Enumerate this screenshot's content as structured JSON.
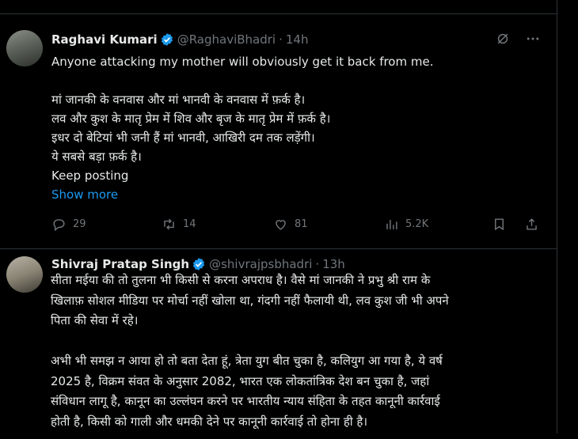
{
  "tweets": [
    {
      "name": "Raghavi Kumari",
      "handle": "@RaghaviBhadri",
      "time": "14h",
      "lines": [
        "Anyone attacking my mother will obviously get it back from me.",
        "",
        "मां जानकी के वनवास और मां भानवी के वनवास में फ़र्क है।",
        "लव और कुश के मातृ प्रेम में शिव और बृज के मातृ प्रेम में फ़र्क है।",
        "इधर दो बेटियां भी जनी हैं मां भानवी, आखिरी दम तक लड़ेंगी।",
        "ये सबसे बड़ा फ़र्क है।",
        "Keep posting"
      ],
      "show_more": "Show more",
      "replies": "29",
      "retweets": "14",
      "likes": "81",
      "views": "5.2K"
    },
    {
      "name": "Shivraj Pratap Singh",
      "handle": "@shivrajpsbhadri",
      "time": "13h",
      "lines": [
        "सीता मईया की तो तुलना भी किसी से करना अपराध है। वैसे मां जानकी ने प्रभु श्री राम के",
        "खिलाफ़ सोशल मीडिया पर मोर्चा नहीं खोला था, गंदगी नहीं फैलायी थी, लव कुश जी भी अपने",
        "पिता की सेवा में रहे।",
        "",
        "अभी भी समझ न आया हो तो बता देता हूं, त्रेता युग बीत चुका है, कलियुग आ गया है, ये वर्ष",
        "2025 है, विक्रम संवत के अनुसार 2082, भारत एक लोकतांत्रिक देश बन चुका है, जहां",
        "संविधान लागू है, कानून का उल्लंघन करने पर भारतीय न्याय संहिता के तहत कानूनी कार्रवाई",
        "होती है, किसी को गाली  और धमकी देने पर कानूनी कार्रवाई तो होना ही है।"
      ]
    }
  ],
  "colors": {
    "accent": "#1d9bf0",
    "muted": "#71767b",
    "text": "#e7e9ea",
    "border": "#2f3336"
  },
  "icons": [
    "grok-icon",
    "more-icon",
    "reply-icon",
    "retweet-icon",
    "like-icon",
    "views-icon",
    "bookmark-icon",
    "share-icon",
    "verified-icon"
  ]
}
